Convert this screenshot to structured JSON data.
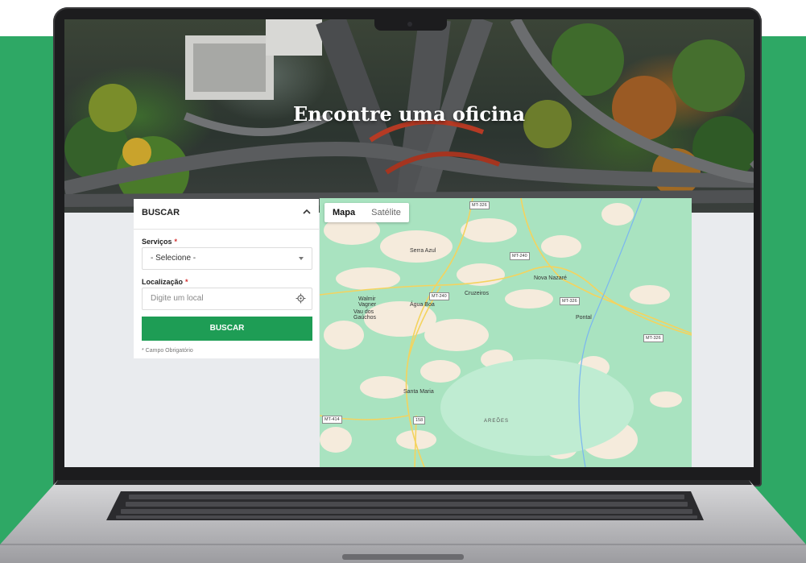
{
  "hero": {
    "title": "Encontre uma oficina"
  },
  "search_panel": {
    "header": "BUSCAR",
    "services_label": "Serviços",
    "services_required": "*",
    "services_selected": "- Selecione -",
    "location_label": "Localização",
    "location_required": "*",
    "location_placeholder": "Digite um local",
    "submit_label": "BUSCAR",
    "required_note": "* Campo Obrigatório"
  },
  "map": {
    "tabs": [
      {
        "label": "Mapa",
        "active": true
      },
      {
        "label": "Satélite",
        "active": false
      }
    ],
    "places": [
      {
        "name": "Serra Azul"
      },
      {
        "name": "Nova Nazaré"
      },
      {
        "name": "Cruzeiros"
      },
      {
        "name": "Walmir"
      },
      {
        "name": "Vagner"
      },
      {
        "name": "Água Boa"
      },
      {
        "name": "Vau dos"
      },
      {
        "name": "Gaúchos"
      },
      {
        "name": "Pontal"
      },
      {
        "name": "Santa Maria"
      },
      {
        "name": "AREÕES"
      }
    ],
    "road_shields": [
      {
        "label": "MT-326"
      },
      {
        "label": "MT-240"
      },
      {
        "label": "MT-240"
      },
      {
        "label": "MT-326"
      },
      {
        "label": "MT-326"
      },
      {
        "label": "MT-414"
      },
      {
        "label": "158"
      }
    ]
  },
  "colors": {
    "background_green": "#2ea865",
    "button_green": "#1e9d55",
    "required_red": "#d32f2f",
    "map_green": "#a9e3c0",
    "map_land": "#f5ebdc"
  },
  "icons": [
    "chevron-up-icon",
    "caret-down-icon",
    "location-target-icon"
  ]
}
